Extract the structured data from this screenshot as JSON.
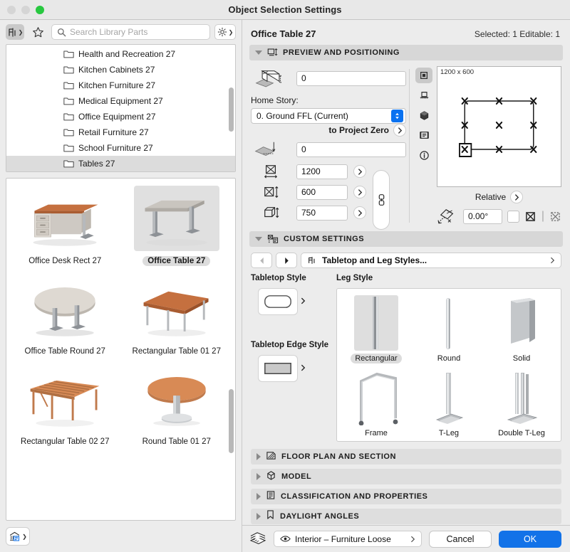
{
  "window": {
    "title": "Object Selection Settings"
  },
  "library": {
    "toolbar": {
      "tool_icon": "furniture-tool-icon",
      "favorites_icon": "star-icon",
      "search_placeholder": "Search Library Parts",
      "search_value": "",
      "settings_icon": "gear-icon"
    },
    "tree_items": [
      {
        "label": "Health and Recreation 27",
        "selected": false
      },
      {
        "label": "Kitchen Cabinets 27",
        "selected": false
      },
      {
        "label": "Kitchen Furniture 27",
        "selected": false
      },
      {
        "label": "Medical Equipment 27",
        "selected": false
      },
      {
        "label": "Office Equipment 27",
        "selected": false
      },
      {
        "label": "Retail Furniture 27",
        "selected": false
      },
      {
        "label": "School Furniture 27",
        "selected": false
      },
      {
        "label": "Tables 27",
        "selected": true
      }
    ],
    "thumbnails": [
      {
        "label": "Office Desk Rect 27",
        "selected": false,
        "kind": "desk-rect"
      },
      {
        "label": "Office Table 27",
        "selected": true,
        "kind": "table-rect-tleg"
      },
      {
        "label": "Office Table Round 27",
        "selected": false,
        "kind": "table-round-tleg"
      },
      {
        "label": "Rectangular Table 01 27",
        "selected": false,
        "kind": "table-square-wood"
      },
      {
        "label": "Rectangular Table 02 27",
        "selected": false,
        "kind": "table-slat-wood"
      },
      {
        "label": "Round Table 01 27",
        "selected": false,
        "kind": "table-round-pedestal"
      }
    ],
    "footer_icon": "library-manager-icon"
  },
  "details": {
    "object_name": "Office Table 27",
    "selection_status": "Selected: 1 Editable: 1",
    "preview_positioning": {
      "section_title": "PREVIEW AND POSITIONING",
      "section_icon": "preview-positioning-icon",
      "expanded": true,
      "elevation_value": "0",
      "home_story_label": "Home Story:",
      "home_story_value": "0. Ground FFL (Current)",
      "to_project_zero_label": "to Project Zero",
      "project_zero_value": "0",
      "width_value": "1200",
      "depth_value": "600",
      "height_value": "750",
      "view_icons": [
        {
          "name": "symbol-view-icon",
          "active": true
        },
        {
          "name": "elevation-view-icon",
          "active": false
        },
        {
          "name": "3d-view-icon",
          "active": false
        },
        {
          "name": "list-view-icon",
          "active": false
        },
        {
          "name": "info-view-icon",
          "active": false
        }
      ],
      "preview_dimension_label": "1200 x 600",
      "relative_label": "Relative",
      "rotation_value": "0.00°",
      "anchor_selected_index": 6
    },
    "custom_settings": {
      "section_title": "CUSTOM SETTINGS",
      "section_icon": "custom-settings-icon",
      "expanded": true,
      "nav_prev_icon": "prev-arrow-icon",
      "nav_next_icon": "next-arrow-icon",
      "page_label": "Tabletop and Leg Styles...",
      "page_icon": "table-icon",
      "tabletop_style_label": "Tabletop Style",
      "tabletop_edge_style_label": "Tabletop Edge Style",
      "leg_style_label": "Leg Style",
      "leg_styles": [
        {
          "label": "Rectangular",
          "selected": true,
          "kind": "rectangular"
        },
        {
          "label": "Round",
          "selected": false,
          "kind": "round"
        },
        {
          "label": "Solid",
          "selected": false,
          "kind": "solid"
        },
        {
          "label": "Frame",
          "selected": false,
          "kind": "frame"
        },
        {
          "label": "T-Leg",
          "selected": false,
          "kind": "tleg"
        },
        {
          "label": "Double T-Leg",
          "selected": false,
          "kind": "double-tleg"
        }
      ]
    },
    "collapsed_sections": [
      {
        "title": "FLOOR PLAN AND SECTION",
        "icon": "floor-plan-icon"
      },
      {
        "title": "MODEL",
        "icon": "model-cube-icon"
      },
      {
        "title": "CLASSIFICATION AND PROPERTIES",
        "icon": "classification-icon"
      },
      {
        "title": "DAYLIGHT ANGLES",
        "icon": "daylight-bookmark-icon"
      }
    ]
  },
  "footer": {
    "layer_icon": "layers-icon",
    "layer_eye_icon": "eye-icon",
    "layer_value": "Interior – Furniture Loose",
    "cancel_label": "Cancel",
    "ok_label": "OK"
  },
  "colors": {
    "accent": "#1272e8",
    "stepper": "#0a72f0",
    "selection_bg": "#dcdcdc",
    "section_bg": "#d7d7d7"
  }
}
